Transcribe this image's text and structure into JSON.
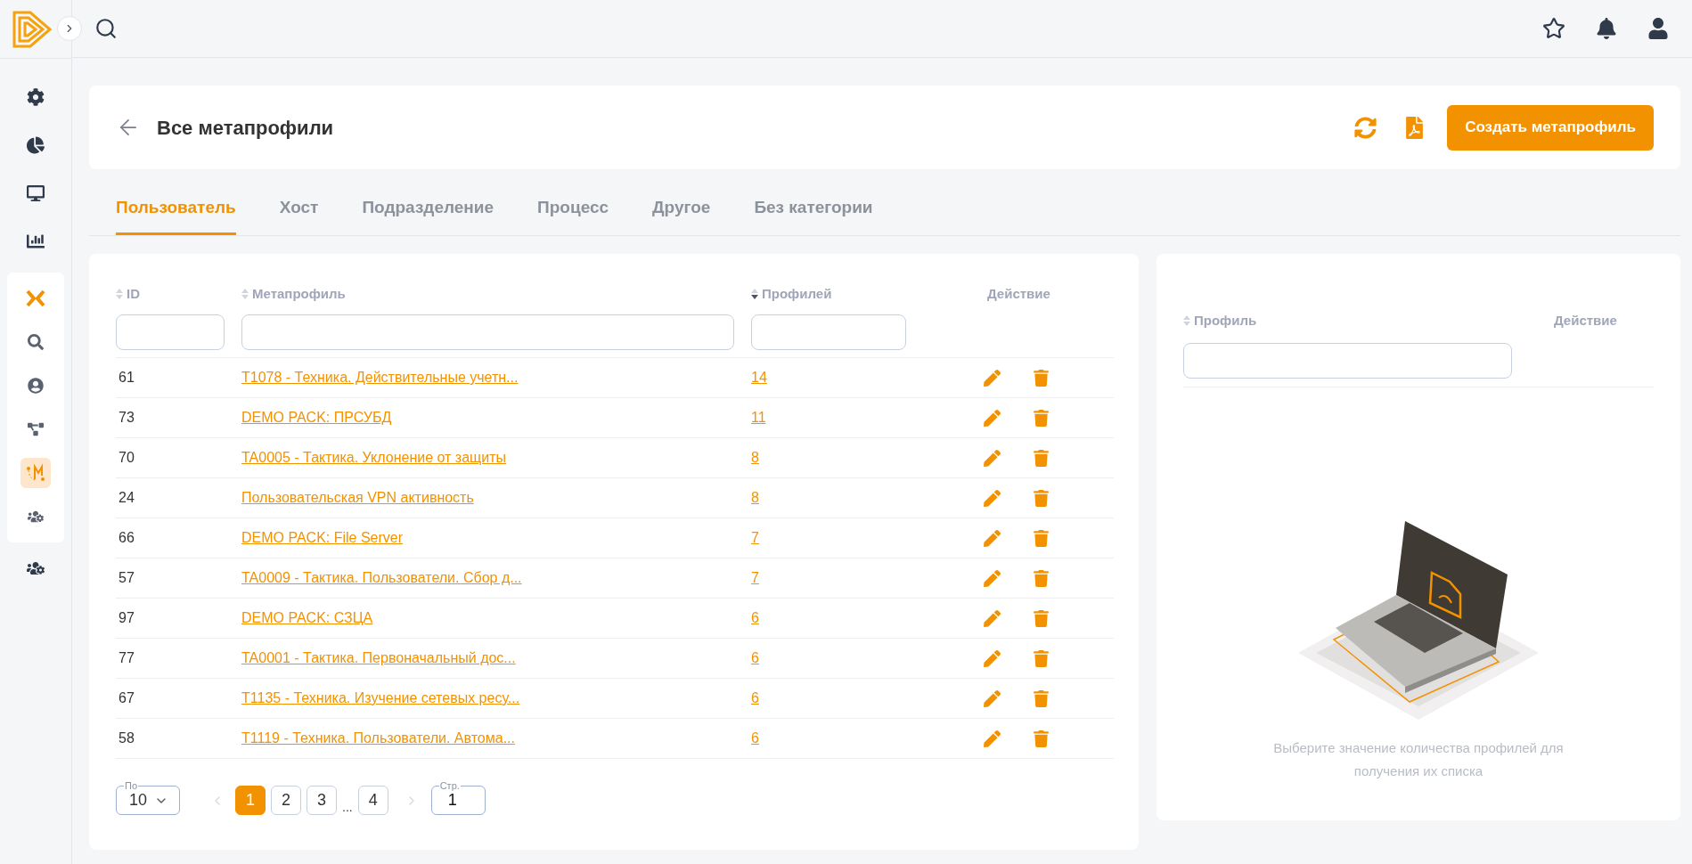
{
  "sidebar": {
    "top_items": [
      {
        "selected": false
      },
      {
        "selected": false
      },
      {
        "selected": false
      },
      {
        "selected": false
      }
    ],
    "group_items": [
      {
        "selected": false
      },
      {
        "selected": false
      },
      {
        "selected": false
      },
      {
        "selected": false
      },
      {
        "selected": true
      },
      {
        "selected": false
      }
    ],
    "bottom_items": [
      {
        "selected": false
      }
    ]
  },
  "header": {
    "title": "Все метапрофили",
    "create_button": "Создать метапрофиль"
  },
  "tabs": [
    {
      "label": "Пользователь",
      "selected": true
    },
    {
      "label": "Хост",
      "selected": false
    },
    {
      "label": "Подразделение",
      "selected": false
    },
    {
      "label": "Процесс",
      "selected": false
    },
    {
      "label": "Другое",
      "selected": false
    },
    {
      "label": "Без категории",
      "selected": false
    }
  ],
  "table": {
    "columns": [
      {
        "label": "ID",
        "sortable": true,
        "sorted_descending": false,
        "filter": true
      },
      {
        "label": "Метапрофиль",
        "sortable": true,
        "sorted_descending": false,
        "filter": true
      },
      {
        "label": "Профилей",
        "sortable": true,
        "sorted_descending": true,
        "filter": true
      },
      {
        "label": "Действие",
        "sortable": false,
        "filter": false
      }
    ],
    "rows": [
      {
        "id": "61",
        "name": "T1078 - Техника. Действительные учетн...",
        "count": "14"
      },
      {
        "id": "73",
        "name": "DEMO PACK: ПРСУБД",
        "count": "11"
      },
      {
        "id": "70",
        "name": "TA0005 - Тактика. Уклонение от защиты",
        "count": "8"
      },
      {
        "id": "24",
        "name": "Пользовательская VPN активность",
        "count": "8"
      },
      {
        "id": "66",
        "name": "DEMO PACK: File Server",
        "count": "7"
      },
      {
        "id": "57",
        "name": "TA0009 - Тактика. Пользователи. Сбор д...",
        "count": "7"
      },
      {
        "id": "97",
        "name": "DEMO PACK: СЗЦА",
        "count": "6"
      },
      {
        "id": "77",
        "name": "TA0001 - Тактика. Первоначальный дос...",
        "count": "6"
      },
      {
        "id": "67",
        "name": "T1135 - Техника. Изучение сетевых ресу...",
        "count": "6"
      },
      {
        "id": "58",
        "name": "T1119 - Техника. Пользователи. Автома...",
        "count": "6"
      }
    ]
  },
  "pagination": {
    "per_page_label": "По",
    "per_page": "10",
    "prev_disabled": true,
    "next_disabled": true,
    "pages": [
      {
        "label": "1",
        "selected": true
      },
      {
        "label": "2",
        "selected": false
      },
      {
        "label": "3",
        "selected": false
      },
      {
        "kind": "ellipsis",
        "label": "..."
      },
      {
        "label": "4",
        "selected": false
      }
    ],
    "page_field_label": "Стр.",
    "page_field_value": "1"
  },
  "detail": {
    "columns": [
      {
        "label": "Профиль",
        "sortable": true,
        "sorted_descending": false,
        "filter": true
      },
      {
        "label": "Действие",
        "sortable": false,
        "filter": false
      }
    ],
    "empty_message": "Выберите значение количества профилей для получения их списка"
  }
}
